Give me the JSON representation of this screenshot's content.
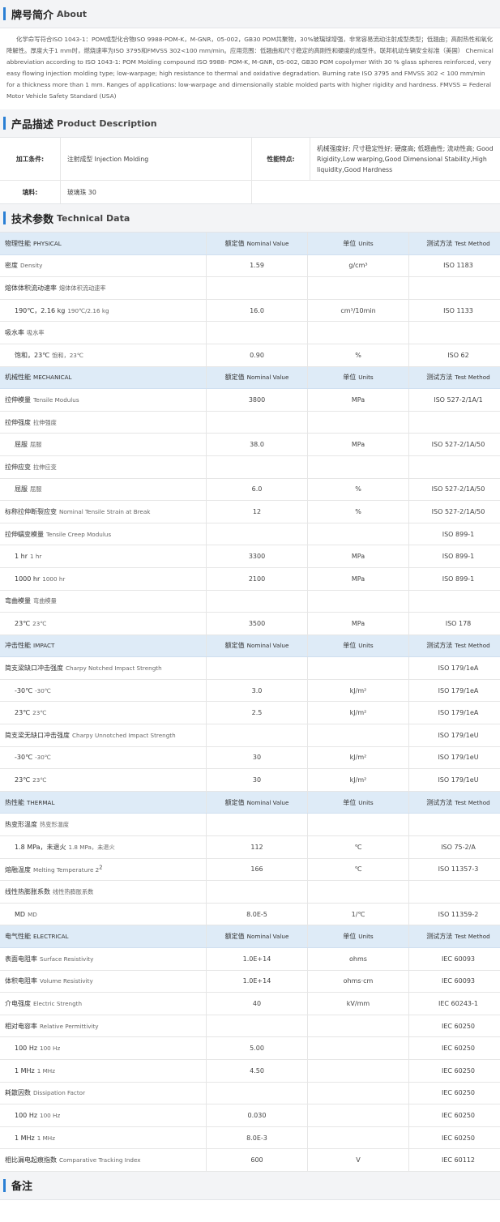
{
  "about": {
    "title_cn": "牌号简介",
    "title_en": "About",
    "text": "化学命写符合ISO 1043-1：POM成型化合物ISO 9988-POM-K，M-GNR，05-002，GB30 POM共聚物，30%玻璃球增强，非常容易流动注射成型类型；低翘曲；高耐热性和氧化降解性。厚度大于1 mm时，燃烧速率为ISO 3795和FMVSS 302<100 mm/min。应用范围：低翘曲和尺寸稳定的高刚性和硬度的成型件。联邦机动车辆安全标准（美国） Chemical abbreviation according to ISO 1043-1: POM Molding compound ISO 9988- POM-K, M-GNR, 05-002, GB30 POM copolymer With 30 % glass spheres reinforced, very easy flowing injection molding type; low-warpage; high resistance to thermal and oxidative degradation. Burning rate ISO 3795 and FMVSS 302 < 100 mm/min for a thickness more than 1 mm. Ranges of applications: low-warpage and dimensionally stable molded parts with higher rigidity and hardness. FMVSS = Federal Motor Vehicle Safety Standard (USA)"
  },
  "product": {
    "title_cn": "产品描述",
    "title_en": "Product Description",
    "processing_label": "加工条件:",
    "processing_value": "注射成型 Injection Molding",
    "features_label": "性能特点:",
    "features_value": "机械强度好; 尺寸稳定性好; 硬度高; 低翘曲性; 流动性高; Good Rigidity,Low warping,Good Dimensional Stability,High liquidity,Good Hardness",
    "filler_label": "填料:",
    "filler_value": "玻璃珠 30"
  },
  "tech": {
    "title_cn": "技术参数",
    "title_en": "Technical Data",
    "rows": [
      {
        "type": "cat",
        "cn": "物理性能",
        "en": "PHYSICAL",
        "v_cn": "额定值",
        "v_en": "Nominal Value",
        "u_cn": "单位",
        "u_en": "Units",
        "m_cn": "测试方法",
        "m_en": "Test Method"
      },
      {
        "type": "row",
        "cn": "密度",
        "en": "Density",
        "value": "1.59",
        "unit": "g/cm³",
        "method": "ISO 1183"
      },
      {
        "type": "row",
        "cn": "熔体体积流动速率",
        "en": "熔体体积流动速率",
        "value": "",
        "unit": "",
        "method": ""
      },
      {
        "type": "sub",
        "cn": "190℃，2.16 kg",
        "en": "190℃/2.16 kg",
        "value": "16.0",
        "unit": "cm³/10min",
        "method": "ISO 1133",
        "link": true
      },
      {
        "type": "row",
        "cn": "吸水率",
        "en": "吸水率",
        "value": "",
        "unit": "",
        "method": ""
      },
      {
        "type": "sub",
        "cn": "饱和，23℃",
        "en": "饱和，23℃",
        "value": "0.90",
        "unit": "%",
        "method": "ISO 62",
        "link": true
      },
      {
        "type": "cat",
        "cn": "机械性能",
        "en": "MECHANICAL",
        "v_cn": "额定值",
        "v_en": "Nominal Value",
        "u_cn": "单位",
        "u_en": "Units",
        "m_cn": "测试方法",
        "m_en": "Test Method"
      },
      {
        "type": "row",
        "cn": "拉伸模量",
        "en": "Tensile Modulus",
        "value": "3800",
        "unit": "MPa",
        "method": "ISO 527-2/1A/1"
      },
      {
        "type": "row",
        "cn": "拉伸强度",
        "en": "拉伸强度",
        "value": "",
        "unit": "",
        "method": ""
      },
      {
        "type": "sub",
        "cn": "屈服",
        "en": "屈服",
        "value": "38.0",
        "unit": "MPa",
        "method": "ISO 527-2/1A/50"
      },
      {
        "type": "row",
        "cn": "拉伸应变",
        "en": "拉伸应变",
        "value": "",
        "unit": "",
        "method": ""
      },
      {
        "type": "sub",
        "cn": "屈服",
        "en": "屈服",
        "value": "6.0",
        "unit": "%",
        "method": "ISO 527-2/1A/50"
      },
      {
        "type": "row",
        "cn": "标称拉伸断裂应变",
        "en": "Nominal Tensile Strain at Break",
        "value": "12",
        "unit": "%",
        "method": "ISO 527-2/1A/50"
      },
      {
        "type": "row",
        "cn": "拉伸蠕变模量",
        "en": "Tensile Creep Modulus",
        "value": "",
        "unit": "",
        "method": "ISO 899-1"
      },
      {
        "type": "sub",
        "cn": "1 hr",
        "en": "1 hr",
        "value": "3300",
        "unit": "MPa",
        "method": "ISO 899-1"
      },
      {
        "type": "sub",
        "cn": "1000 hr",
        "en": "1000 hr",
        "value": "2100",
        "unit": "MPa",
        "method": "ISO 899-1"
      },
      {
        "type": "row",
        "cn": "弯曲模量",
        "en": "弯曲模量",
        "value": "",
        "unit": "",
        "method": ""
      },
      {
        "type": "sub",
        "cn": "23℃",
        "en": "23℃",
        "value": "3500",
        "unit": "MPa",
        "method": "ISO 178"
      },
      {
        "type": "cat",
        "cn": "冲击性能",
        "en": "IMPACT",
        "v_cn": "额定值",
        "v_en": "Nominal Value",
        "u_cn": "单位",
        "u_en": "Units",
        "m_cn": "测试方法",
        "m_en": "Test Method"
      },
      {
        "type": "row",
        "cn": "简支梁缺口冲击强度",
        "en": "Charpy Notched Impact Strength",
        "value": "",
        "unit": "",
        "method": "ISO 179/1eA"
      },
      {
        "type": "sub",
        "cn": "-30℃",
        "en": "-30℃",
        "value": "3.0",
        "unit": "kJ/m²",
        "method": "ISO 179/1eA"
      },
      {
        "type": "sub",
        "cn": "23℃",
        "en": "23℃",
        "value": "2.5",
        "unit": "kJ/m²",
        "method": "ISO 179/1eA"
      },
      {
        "type": "row",
        "cn": "简支梁无缺口冲击强度",
        "en": "Charpy Unnotched Impact Strength",
        "value": "",
        "unit": "",
        "method": "ISO 179/1eU"
      },
      {
        "type": "sub",
        "cn": "-30℃",
        "en": "-30℃",
        "value": "30",
        "unit": "kJ/m²",
        "method": "ISO 179/1eU"
      },
      {
        "type": "sub",
        "cn": "23℃",
        "en": "23℃",
        "value": "30",
        "unit": "kJ/m²",
        "method": "ISO 179/1eU"
      },
      {
        "type": "cat",
        "cn": "热性能",
        "en": "THERMAL",
        "v_cn": "额定值",
        "v_en": "Nominal Value",
        "u_cn": "单位",
        "u_en": "Units",
        "m_cn": "测试方法",
        "m_en": "Test Method"
      },
      {
        "type": "row",
        "cn": "热变形温度",
        "en": "热变形温度",
        "value": "",
        "unit": "",
        "method": ""
      },
      {
        "type": "sub",
        "cn": "1.8 MPa，未退火",
        "en": "1.8 MPa，未退火",
        "value": "112",
        "unit": "℃",
        "method": "ISO 75-2/A"
      },
      {
        "type": "row",
        "cn": "熔融温度",
        "en": "Melting Temperature  2",
        "sup": "2",
        "value": "166",
        "unit": "℃",
        "method": "ISO 11357-3",
        "link": true
      },
      {
        "type": "row",
        "cn": "线性热膨胀系数",
        "en": "线性热膨胀系数",
        "value": "",
        "unit": "",
        "method": ""
      },
      {
        "type": "sub",
        "cn": "MD",
        "en": "MD",
        "value": "8.0E-5",
        "unit": "1/℃",
        "method": "ISO 11359-2"
      },
      {
        "type": "cat",
        "cn": "电气性能",
        "en": "ELECTRICAL",
        "v_cn": "额定值",
        "v_en": "Nominal Value",
        "u_cn": "单位",
        "u_en": "Units",
        "m_cn": "测试方法",
        "m_en": "Test Method"
      },
      {
        "type": "row",
        "cn": "表面电阻率",
        "en": "Surface Resistivity",
        "value": "1.0E+14",
        "unit": "ohms",
        "method": "IEC 60093"
      },
      {
        "type": "row",
        "cn": "体积电阻率",
        "en": "Volume Resistivity",
        "value": "1.0E+14",
        "unit": "ohms·cm",
        "method": "IEC 60093"
      },
      {
        "type": "row",
        "cn": "介电强度",
        "en": "Electric Strength",
        "value": "40",
        "unit": "kV/mm",
        "method": "IEC 60243-1"
      },
      {
        "type": "row",
        "cn": "相对电容率",
        "en": "Relative Permittivity",
        "value": "",
        "unit": "",
        "method": "IEC 60250"
      },
      {
        "type": "sub",
        "cn": "100 Hz",
        "en": "100 Hz",
        "value": "5.00",
        "unit": "",
        "method": "IEC 60250"
      },
      {
        "type": "sub",
        "cn": "1 MHz",
        "en": "1 MHz",
        "value": "4.50",
        "unit": "",
        "method": "IEC 60250"
      },
      {
        "type": "row",
        "cn": "耗散因数",
        "en": "Dissipation Factor",
        "value": "",
        "unit": "",
        "method": "IEC 60250"
      },
      {
        "type": "sub",
        "cn": "100 Hz",
        "en": "100 Hz",
        "value": "0.030",
        "unit": "",
        "method": "IEC 60250"
      },
      {
        "type": "sub",
        "cn": "1 MHz",
        "en": "1 MHz",
        "value": "8.0E-3",
        "unit": "",
        "method": "IEC 60250"
      },
      {
        "type": "row",
        "cn": "相比漏电起痕指数",
        "en": "Comparative Tracking Index",
        "value": "600",
        "unit": "V",
        "method": "IEC 60112"
      }
    ]
  },
  "notes": {
    "title_cn": "备注"
  },
  "colors": {
    "accent": "#2a7fd4",
    "category_row_bg": "#deebf7",
    "link": "#3a7bd5"
  }
}
